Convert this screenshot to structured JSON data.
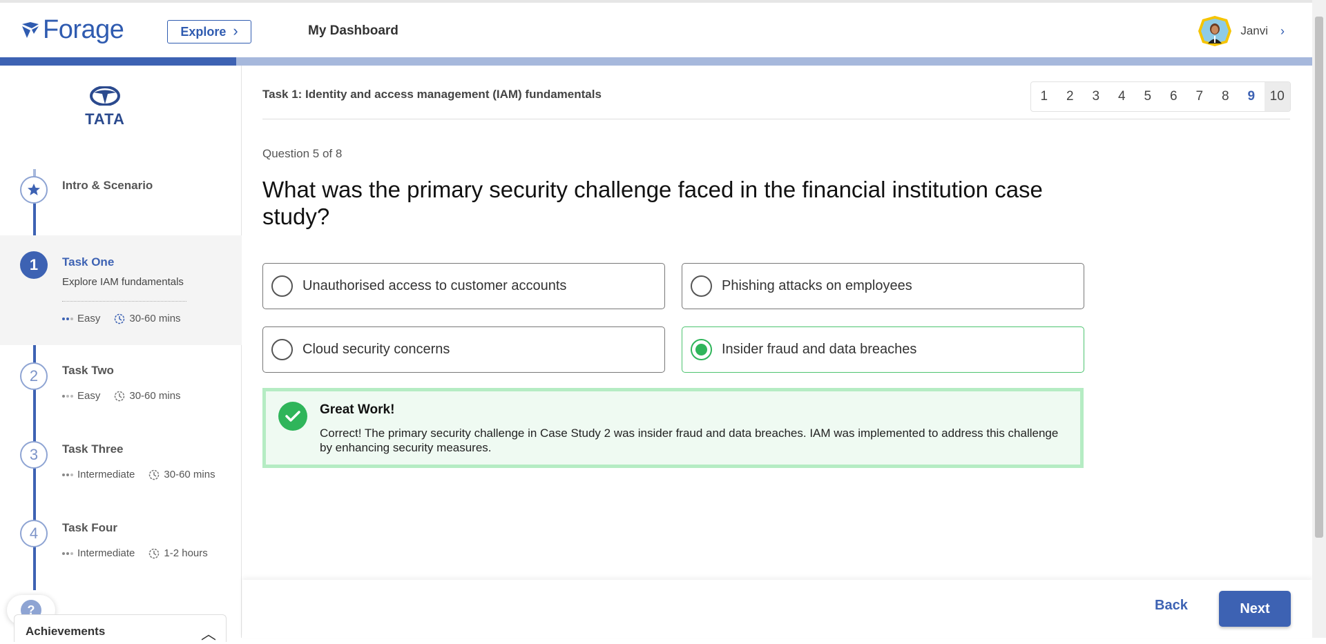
{
  "header": {
    "logo_text": "Forage",
    "explore_label": "Explore",
    "dashboard_label": "My Dashboard",
    "user_name": "Janvi"
  },
  "progress": {
    "fraction": 0.18
  },
  "sidebar": {
    "company": "TATA",
    "steps": [
      {
        "number": "",
        "icon": "star-icon",
        "title": "Intro & Scenario"
      },
      {
        "number": "1",
        "title": "Task One",
        "subtitle": "Explore IAM fundamentals",
        "difficulty": "Easy",
        "duration": "30-60 mins"
      },
      {
        "number": "2",
        "title": "Task Two",
        "difficulty": "Easy",
        "duration": "30-60 mins"
      },
      {
        "number": "3",
        "title": "Task Three",
        "difficulty": "Intermediate",
        "duration": "30-60 mins"
      },
      {
        "number": "4",
        "title": "Task Four",
        "difficulty": "Intermediate",
        "duration": "1-2 hours"
      }
    ],
    "help_label": "?",
    "achievements_label": "Achievements"
  },
  "main": {
    "task_title": "Task 1: Identity and access management (IAM) fundamentals",
    "question_nav": [
      "1",
      "2",
      "3",
      "4",
      "5",
      "6",
      "7",
      "8",
      "9",
      "10"
    ],
    "question_count": "Question 5 of 8",
    "question": "What was the primary security challenge faced in the financial institution case study?",
    "options": [
      "Unauthorised access to customer accounts",
      "Phishing attacks on employees",
      "Cloud security concerns",
      "Insider fraud and data breaches"
    ],
    "selected_option": 3,
    "feedback_title": "Great Work!",
    "feedback_text": "Correct! The primary security challenge in Case Study 2 was insider fraud and data breaches. IAM was implemented to address this challenge by enhancing security measures."
  },
  "footer": {
    "back_label": "Back",
    "next_label": "Next"
  },
  "colors": {
    "brand": "#3d62b3",
    "success": "#2fb55a",
    "success_bg": "#effaf2"
  }
}
